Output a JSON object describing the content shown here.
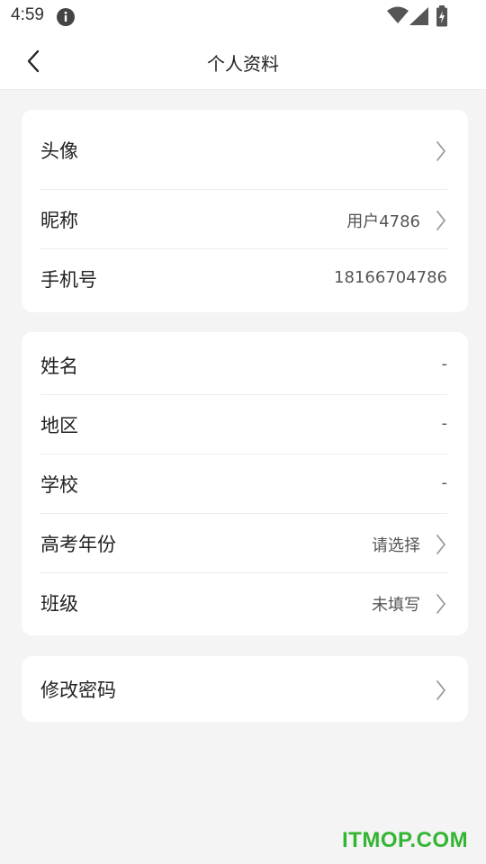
{
  "status_bar": {
    "time": "4:59",
    "icons": [
      "info-icon",
      "wifi-icon",
      "signal-icon",
      "battery-icon"
    ]
  },
  "nav": {
    "title": "个人资料",
    "back_icon": "chevron-left-icon"
  },
  "card1": {
    "rows": [
      {
        "label": "头像",
        "value": "",
        "chevron": true
      },
      {
        "label": "昵称",
        "value": "用户4786",
        "chevron": true
      },
      {
        "label": "手机号",
        "value": "18166704786",
        "chevron": false
      }
    ]
  },
  "card2": {
    "rows": [
      {
        "label": "姓名",
        "value": "-",
        "chevron": false
      },
      {
        "label": "地区",
        "value": "-",
        "chevron": false
      },
      {
        "label": "学校",
        "value": "-",
        "chevron": false
      },
      {
        "label": "高考年份",
        "value": "请选择",
        "chevron": true
      },
      {
        "label": "班级",
        "value": "未填写",
        "chevron": true
      }
    ]
  },
  "card3": {
    "rows": [
      {
        "label": "修改密码",
        "value": "",
        "chevron": true
      }
    ]
  },
  "watermark": "ITMOP.COM",
  "colors": {
    "background": "#f4f4f4",
    "card": "#ffffff",
    "watermark": "#33b533",
    "chevron": "#9a9a9a"
  }
}
